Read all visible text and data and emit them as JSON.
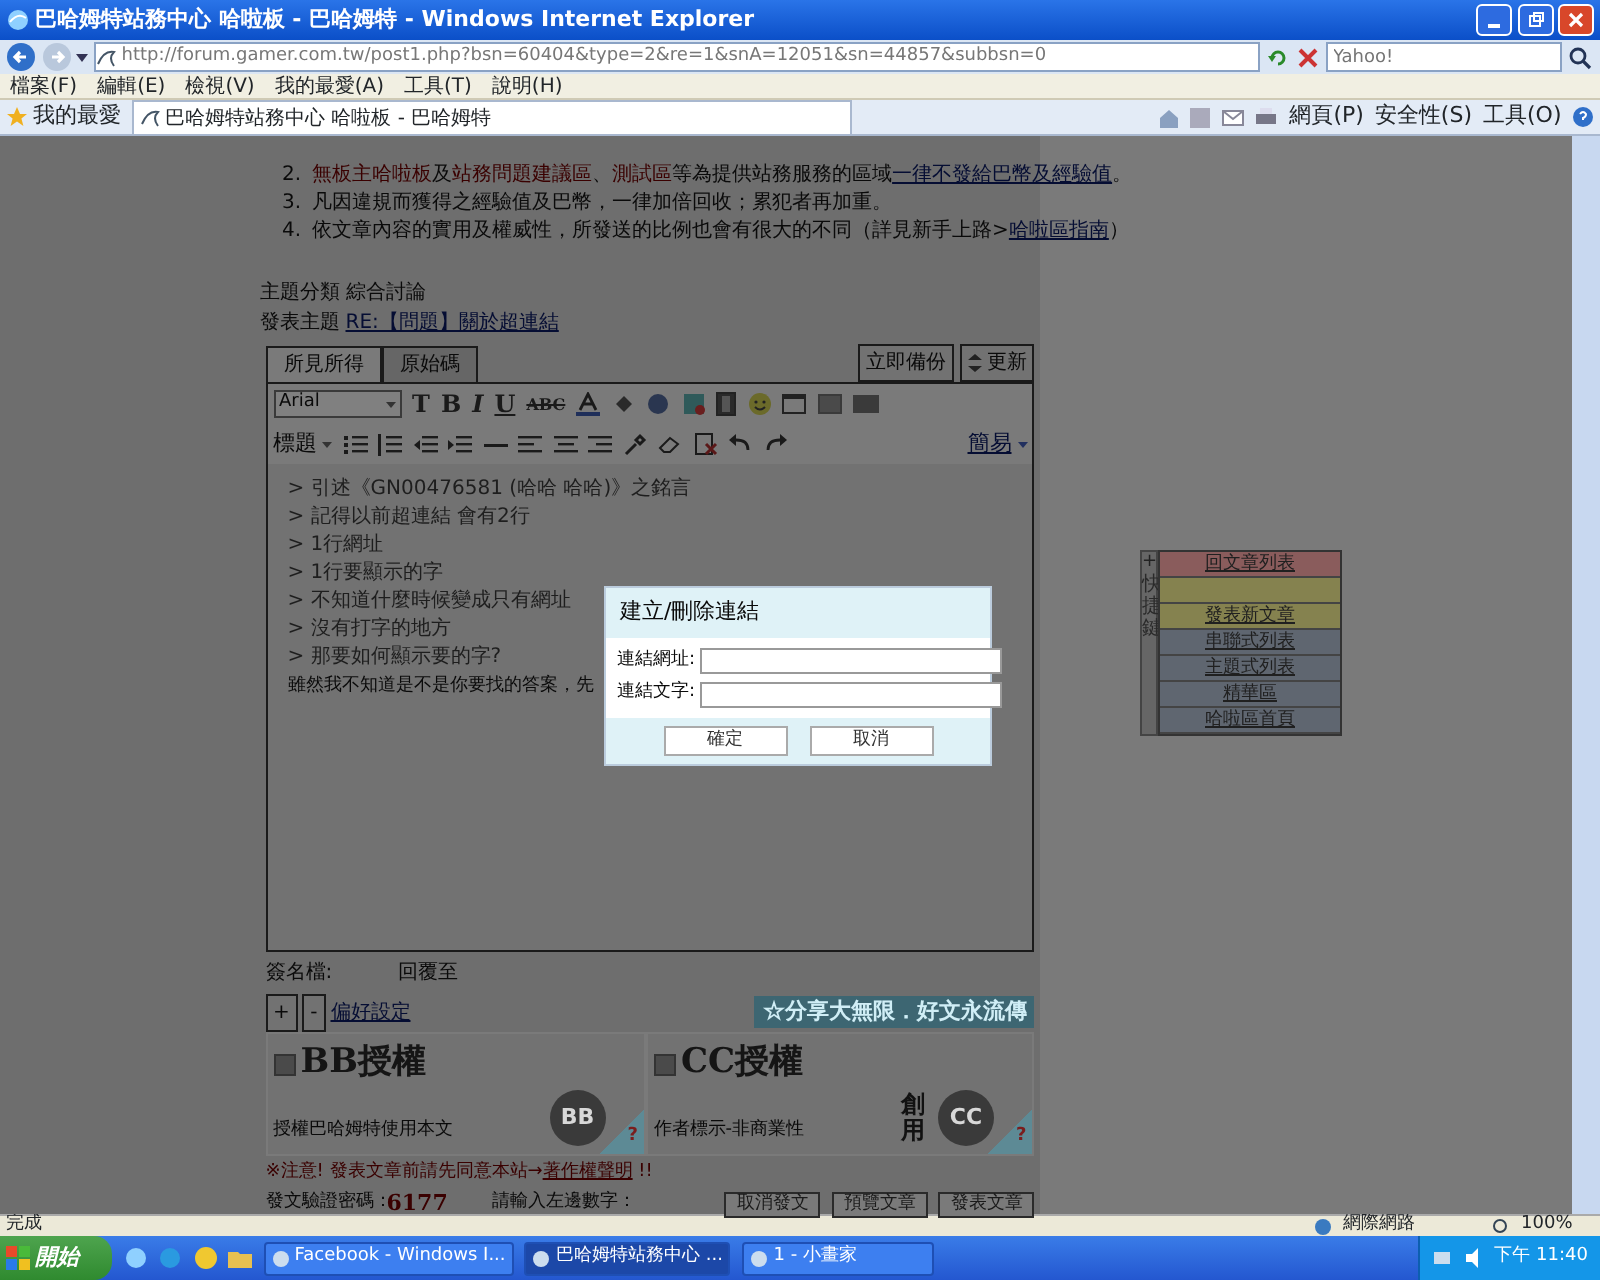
{
  "window": {
    "title": "巴哈姆特站務中心 哈啦板 - 巴哈姆特 - Windows Internet Explorer"
  },
  "address_bar": {
    "url": "http://forum.gamer.com.tw/post1.php?bsn=60404&type=2&re=1&snA=12051&sn=44857&subbsn=0",
    "search_placeholder": "Yahoo!"
  },
  "menu": [
    "檔案(F)",
    "編輯(E)",
    "檢視(V)",
    "我的最愛(A)",
    "工具(T)",
    "說明(H)"
  ],
  "favorites_bar": {
    "favorites": "我的最愛",
    "tab": "巴哈姆特站務中心 哈啦板 - 巴哈姆特",
    "tools": [
      "網頁(P)",
      "安全性(S)",
      "工具(O)"
    ]
  },
  "rules": [
    {
      "number": "2.",
      "parts": [
        {
          "kind": "red",
          "text": "無板主哈啦板"
        },
        {
          "kind": "plain",
          "text": "及"
        },
        {
          "kind": "red",
          "text": "站務問題建議區"
        },
        {
          "kind": "plain",
          "text": "、"
        },
        {
          "kind": "red",
          "text": "測試區"
        },
        {
          "kind": "plain",
          "text": "等為提供站務服務的區域"
        },
        {
          "kind": "link",
          "text": "一律不發給巴幣及經驗值"
        },
        {
          "kind": "plain",
          "text": "。"
        }
      ]
    },
    {
      "number": "3.",
      "parts": [
        {
          "kind": "plain",
          "text": "凡因違規而獲得之經驗值及巴幣，一律加倍回收；累犯者再加重。"
        }
      ]
    },
    {
      "number": "4.",
      "parts": [
        {
          "kind": "plain",
          "text": "依文章內容的實用及權威性，所發送的比例也會有很大的不同（詳見新手上路>"
        },
        {
          "kind": "link",
          "text": "哈啦區指南"
        },
        {
          "kind": "plain",
          "text": "）"
        }
      ]
    }
  ],
  "topic": {
    "category_label": "主題分類",
    "category": "綜合討論",
    "subject_label": "發表主題",
    "subject": "RE:【問題】關於超連結"
  },
  "editor": {
    "tabs": [
      {
        "label": "所見所得",
        "selected": true
      },
      {
        "label": "原始碼",
        "selected": false
      }
    ],
    "backup": "立即備份",
    "refresh": "更新",
    "font": "Arial",
    "size": "T",
    "bold": "B",
    "italic": "I",
    "underline": "U",
    "strike": "ABC",
    "format": "標題",
    "mode": "簡易",
    "quote_lines": [
      "> 引述《GN00476581 (哈哈 哈哈)》之銘言",
      "> 記得以前超連結 會有2行",
      "> 1行網址",
      "> 1行要顯示的字",
      "> 不知道什麼時候變成只有網址",
      "> 沒有打字的地方",
      "> 那要如何顯示要的字?"
    ],
    "body_line": "雖然我不知道是不是你要找的答案，先"
  },
  "link_dialog": {
    "title": "建立/刪除連結",
    "fields": [
      {
        "label": "連結網址:"
      },
      {
        "label": "連結文字:"
      }
    ],
    "buttons": [
      "確定",
      "取消"
    ]
  },
  "quick_panel": {
    "plus": "+",
    "label": "快捷鍵",
    "items": [
      {
        "label": "回文章列表",
        "color": "#8a5c5c"
      },
      {
        "color": "#85824f"
      },
      {
        "label": "發表新文章",
        "color": "#85824f"
      },
      {
        "label": "串聯式列表",
        "color": "#5f6670"
      },
      {
        "label": "主題式列表",
        "color": "#5f6670"
      },
      {
        "label": "精華區",
        "color": "#5f6670"
      },
      {
        "label": "哈啦區首頁",
        "color": "#5f6670"
      }
    ]
  },
  "signature": {
    "label": "簽名檔:",
    "reply_to": "回覆至"
  },
  "preferences": {
    "plus": "+",
    "minus": "-",
    "link": "偏好設定"
  },
  "banner": "☆分享大無限．好文永流傳",
  "licenses": [
    {
      "title": "BB授權",
      "desc": "授權巴哈姆特使用本文",
      "badge": "BB",
      "help": "?",
      "checked": false
    },
    {
      "title": "CC授權",
      "desc": "作者標示-非商業性",
      "badge": "CC",
      "badge_word": "創用",
      "help": "?",
      "checked": false
    }
  ],
  "notice": {
    "text": "※注意! 發表文章前請先同意本站→",
    "link": "著作權聲明",
    "suffix": "!!"
  },
  "captcha": {
    "label": "發文驗證密碼：",
    "code": "6177",
    "prompt": "請輸入左邊數字："
  },
  "actions": [
    "取消發文",
    "預覽文章",
    "發表文章"
  ],
  "status_bar": {
    "text": "完成",
    "zone": "網際網路",
    "zoom": "100%"
  },
  "taskbar": {
    "start": "開始",
    "tasks": [
      {
        "label": "Facebook - Windows I...",
        "selected": false
      },
      {
        "label": "巴哈姆特站務中心 ...",
        "selected": true
      },
      {
        "label": "1 - 小畫家",
        "selected": false
      }
    ],
    "clock": "下午 11:40"
  }
}
